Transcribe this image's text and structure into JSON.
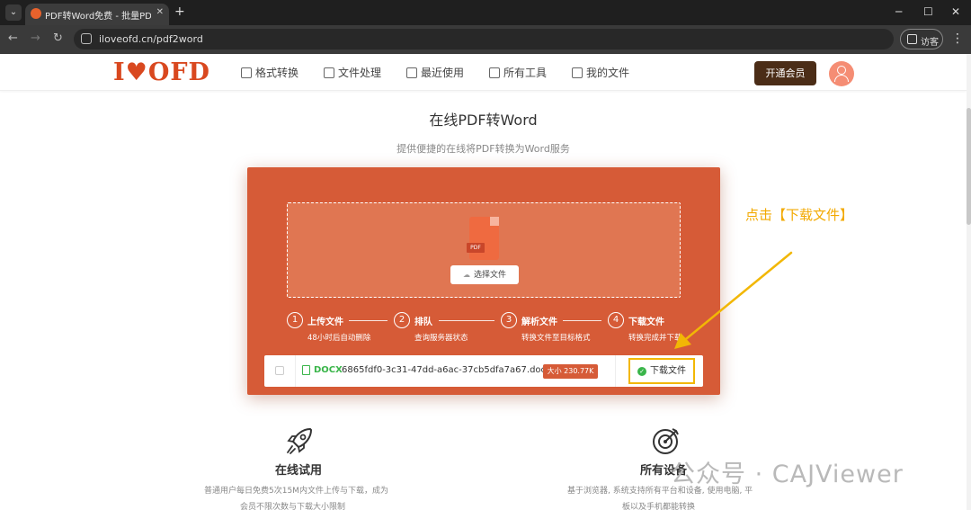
{
  "browser": {
    "tab_title": "PDF转Word免费 - 批量PDF转Wo",
    "tab_close": "✕",
    "new_tab": "+",
    "url": "iloveofd.cn/pdf2word",
    "guest_label": "访客",
    "icons": [
      "tab-search-icon",
      "back-icon",
      "forward-icon",
      "reload-icon",
      "site-info-icon",
      "guest-profile-icon",
      "menu-icon",
      "minimize-icon",
      "maximize-icon",
      "close-icon"
    ]
  },
  "header": {
    "logo_left": "I",
    "logo_right": "OFD",
    "nav": [
      {
        "label": "格式转换"
      },
      {
        "label": "文件处理"
      },
      {
        "label": "最近使用"
      },
      {
        "label": "所有工具"
      },
      {
        "label": "我的文件"
      }
    ],
    "vip_label": "开通会员"
  },
  "main": {
    "title": "在线PDF转Word",
    "subtitle": "提供便捷的在线将PDF转换为Word服务",
    "upload": {
      "file_badge": "PDF",
      "choose_label": "选择文件"
    },
    "steps": [
      {
        "num": "1",
        "title": "上传文件",
        "desc": "48小时后自动删除"
      },
      {
        "num": "2",
        "title": "排队",
        "desc": "查询服务器状态"
      },
      {
        "num": "3",
        "title": "解析文件",
        "desc": "转换文件至目标格式"
      },
      {
        "num": "4",
        "title": "下载文件",
        "desc": "转换完成并下载"
      }
    ],
    "file": {
      "type": "DOCX",
      "name": "6865fdf0-3c31-47dd-a6ac-37cb5dfa7a67.docx",
      "size": "大小 230.77K",
      "download_label": "下载文件"
    }
  },
  "annotation": {
    "text": "点击【下载文件】",
    "color": "#f2a900"
  },
  "features": [
    {
      "title": "在线试用",
      "desc_line1": "普通用户每日免费5次15M内文件上传与下载，成为",
      "desc_line2": "会员不限次数与下载大小限制"
    },
    {
      "title": "所有设备",
      "desc_line1": "基于浏览器, 系统支持所有平台和设备, 使用电脑, 平",
      "desc_line2": "板以及手机都能转换"
    }
  ],
  "watermark": "公众号 · CAJViewer",
  "colors": {
    "brand": "#d65b37",
    "vip": "#4b2d17",
    "success": "#3ab54a",
    "highlight": "#f2b705"
  }
}
